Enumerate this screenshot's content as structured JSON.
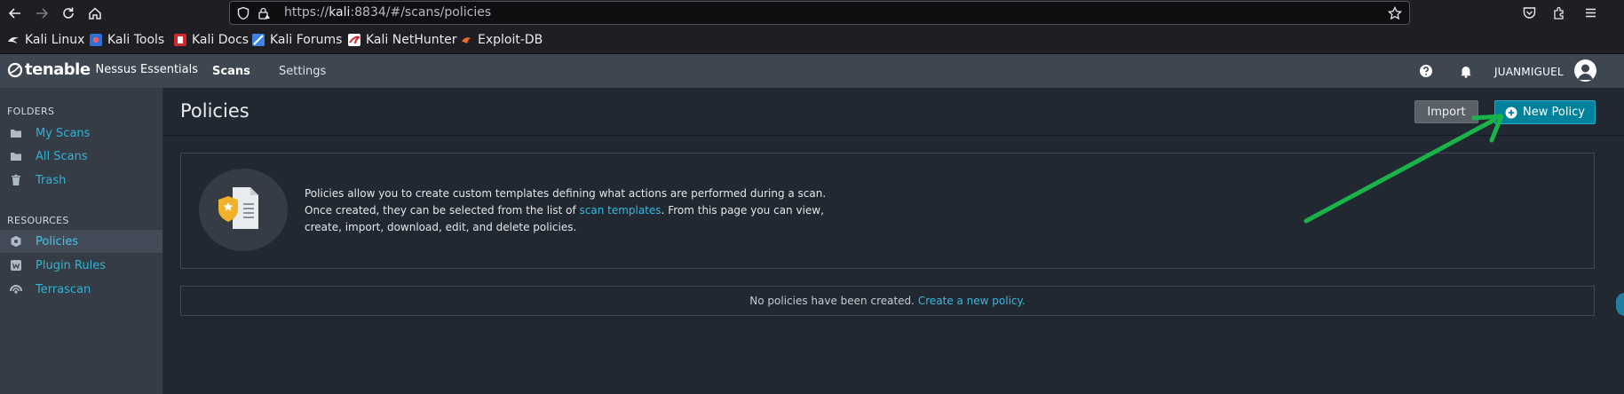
{
  "browser": {
    "url_prefix": "https://",
    "url_host": "kali",
    "url_rest": ":8834/#/scans/policies",
    "bookmarks": [
      {
        "label": "Kali Linux",
        "icon": "kali-dragon-icon"
      },
      {
        "label": "Kali Tools",
        "icon": "kali-tools-icon"
      },
      {
        "label": "Kali Docs",
        "icon": "kali-docs-icon"
      },
      {
        "label": "Kali Forums",
        "icon": "kali-forums-icon"
      },
      {
        "label": "Kali NetHunter",
        "icon": "kali-nethunter-icon"
      },
      {
        "label": "Exploit-DB",
        "icon": "exploit-db-icon"
      }
    ]
  },
  "header": {
    "logo_word": "tenable",
    "logo_sub": "Nessus Essentials",
    "nav": {
      "scans": "Scans",
      "settings": "Settings"
    },
    "username": "JUANMIGUEL"
  },
  "sidebar": {
    "folders_heading": "FOLDERS",
    "folders": [
      {
        "label": "My Scans",
        "icon": "folder-icon"
      },
      {
        "label": "All Scans",
        "icon": "folder-icon"
      },
      {
        "label": "Trash",
        "icon": "trash-icon"
      }
    ],
    "resources_heading": "RESOURCES",
    "resources": [
      {
        "label": "Policies",
        "icon": "policy-shield-icon",
        "active": true
      },
      {
        "label": "Plugin Rules",
        "icon": "plugin-rules-icon"
      },
      {
        "label": "Terrascan",
        "icon": "terrascan-icon"
      }
    ]
  },
  "main": {
    "title": "Policies",
    "import_label": "Import",
    "new_policy_label": "New Policy",
    "info": {
      "text_before": "Policies allow you to create custom templates defining what actions are performed during a scan. Once created, they can be selected from the list of ",
      "link": "scan templates",
      "text_after": ". From this page you can view, create, import, download, edit, and delete policies."
    },
    "empty": {
      "text": "No policies have been created.",
      "link": "Create a new policy."
    }
  },
  "colors": {
    "accent": "#00819c",
    "link": "#37b9dd",
    "annotation_arrow": "#19b34a"
  }
}
